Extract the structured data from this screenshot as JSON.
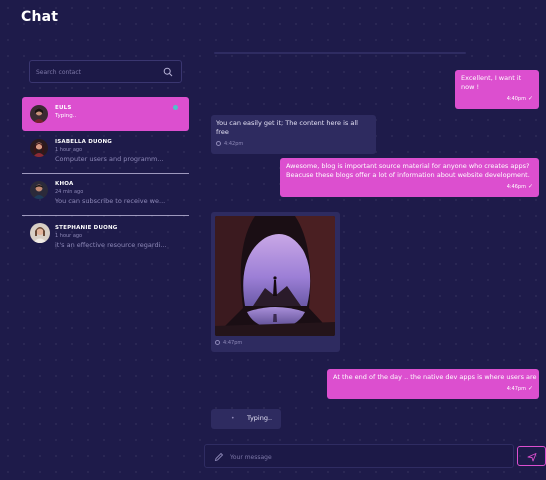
{
  "header": {
    "title": "Chat"
  },
  "search": {
    "placeholder": "Search contact"
  },
  "contacts": [
    {
      "name": "EULS",
      "status": "Typing..",
      "active": true
    },
    {
      "name": "ISABELLA DUONG",
      "time": "1 hour ago",
      "preview": "Computer users and programm..."
    },
    {
      "name": "KHOA",
      "time": "24 min ago",
      "preview": "You can subscribe to receive we..."
    },
    {
      "name": "STEPHANIE DUONG",
      "time": "1 hour ago",
      "preview": "it's an effective resource regardi..."
    }
  ],
  "messages": [
    {
      "direction": "out",
      "text": "Excellent, I want it now !",
      "time": "4:40pm"
    },
    {
      "direction": "in",
      "text": "You can easily get it; The content here is all free",
      "time": "4:42pm"
    },
    {
      "direction": "out",
      "text_line1": "Awesome, blog is important source material for anyone who creates apps?",
      "text_line2": "Beacuse these blogs offer a lot of information about website development.",
      "time": "4:46pm"
    },
    {
      "direction": "in",
      "type": "image",
      "image_icon": "landscape-photo",
      "time": "4:47pm"
    },
    {
      "direction": "out",
      "text": "At the end of the day .. the native dev apps is where users are",
      "time": "4:47pm"
    }
  ],
  "typing_indicator": {
    "label": "Typing..",
    "dots": "•"
  },
  "composer": {
    "placeholder": "Your message"
  },
  "icons": {
    "search": "search-icon",
    "pen": "pen-icon",
    "send": "send-icon",
    "check": "check-icon",
    "clock": "clock-icon"
  },
  "colors": {
    "background": "#1e1b4a",
    "accent": "#dc4fcf",
    "bubble_in": "#2e2b60",
    "online_dot": "#4fc3c9"
  }
}
